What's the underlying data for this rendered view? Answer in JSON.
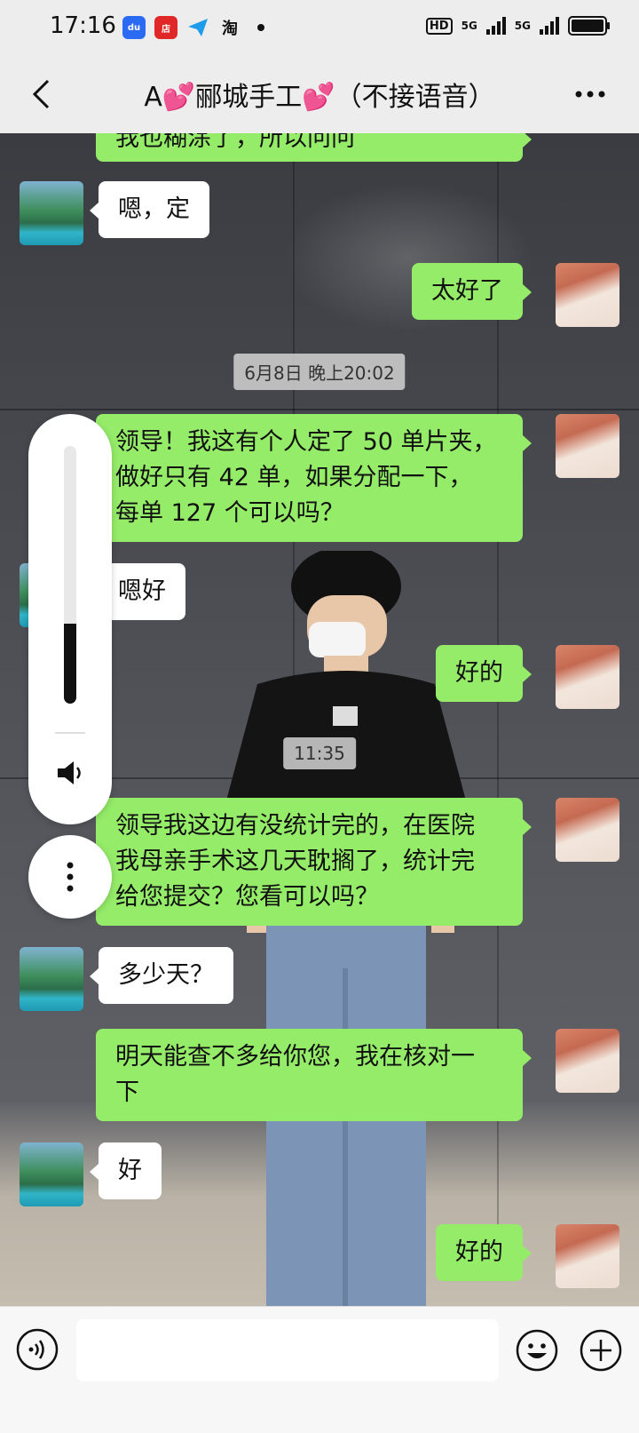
{
  "status_bar": {
    "time": "17:16",
    "apps": [
      {
        "name": "baidu-app-icon",
        "color": "#2b6bf3",
        "glyph": "du"
      },
      {
        "name": "store-app-icon",
        "color": "#e02828",
        "glyph": "店"
      },
      {
        "name": "send-app-icon",
        "color": "#ffffff",
        "glyph": ""
      },
      {
        "name": "taobao-app-icon",
        "color": "#ffffff",
        "glyph": "淘"
      }
    ],
    "network_1": "HD",
    "network_2": "5G",
    "network_3": "5G"
  },
  "nav": {
    "title": "A💕郦城手工💕（不接语音）"
  },
  "messages": [
    {
      "side": "out",
      "text": "我也糊涂了，所以问问"
    },
    {
      "side": "in",
      "text": "嗯，定"
    },
    {
      "side": "out",
      "text": "太好了"
    },
    {
      "type": "time",
      "text": "6月8日 晚上20:02"
    },
    {
      "side": "out",
      "text": "领导！我这有个人定了 50 单片夹，\n做好只有 42 单，如果分配一下，\n每单 127 个可以吗？"
    },
    {
      "side": "in",
      "text": "嗯好"
    },
    {
      "side": "out",
      "text": "好的"
    },
    {
      "type": "time",
      "text": "11:35"
    },
    {
      "side": "out",
      "text": "领导我这边有没统计完的，在医院\n我母亲手术这几天耽搁了，统计完\n给您提交？您看可以吗？"
    },
    {
      "side": "in",
      "text": "多少天？"
    },
    {
      "side": "out",
      "text": "明天能查不多给你您，我在核对一\n下"
    },
    {
      "side": "in",
      "text": "好"
    },
    {
      "side": "out",
      "text": "好的"
    }
  ],
  "volume": {
    "level": 0.31
  },
  "colors": {
    "out_bubble": "#95ec69",
    "in_bubble": "#ffffff",
    "bar_bg": "#ededed"
  },
  "input": {
    "value": "",
    "placeholder": ""
  }
}
